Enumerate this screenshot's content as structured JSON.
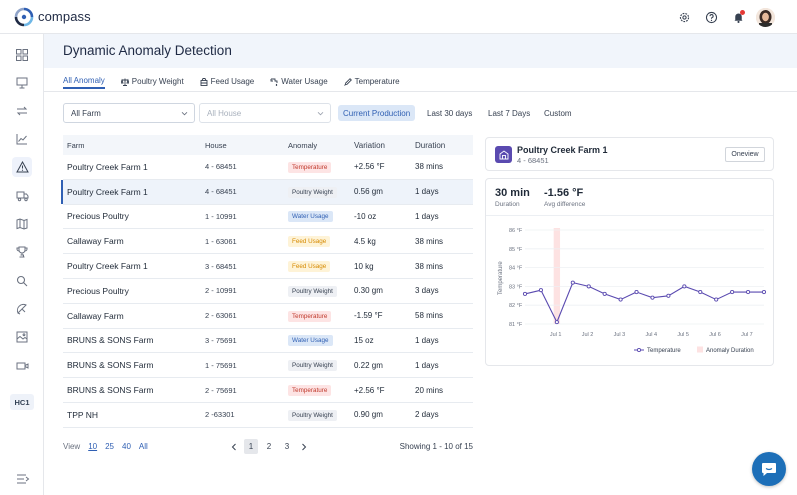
{
  "app": {
    "name": "compass"
  },
  "header": {
    "title": "Dynamic Anomaly Detection"
  },
  "sidebar": {
    "items": [
      {
        "icon": "grid-icon"
      },
      {
        "icon": "presentation-icon"
      },
      {
        "icon": "transfer-icon"
      },
      {
        "icon": "line-chart-icon"
      },
      {
        "icon": "warning-icon",
        "active": true
      },
      {
        "icon": "truck-icon"
      },
      {
        "icon": "map-icon"
      },
      {
        "icon": "trophy-icon"
      },
      {
        "icon": "search-icon"
      },
      {
        "icon": "satellite-icon"
      },
      {
        "icon": "image-icon"
      },
      {
        "icon": "video-icon"
      }
    ],
    "badge": "HC1"
  },
  "tabs": [
    {
      "label": "All Anomaly",
      "active": true
    },
    {
      "label": "Poultry Weight",
      "icon": "scale-icon"
    },
    {
      "label": "Feed Usage",
      "icon": "feed-icon"
    },
    {
      "label": "Water Usage",
      "icon": "water-icon"
    },
    {
      "label": "Temperature",
      "icon": "thermometer-icon"
    }
  ],
  "filters": {
    "farm": "All Farm",
    "house_placeholder": "All House",
    "periods": [
      "Current Production",
      "Last 30 days",
      "Last 7 Days",
      "Custom"
    ],
    "active_period": "Current Production"
  },
  "table": {
    "columns": [
      "Farm",
      "House",
      "Anomaly",
      "Variation",
      "Duration"
    ],
    "rows": [
      {
        "farm": "Poultry Creek Farm 1",
        "house": "4 - 68451",
        "anomaly": "Temperature",
        "variation": "+2.56  °F",
        "duration": "38 mins"
      },
      {
        "farm": "Poultry Creek Farm 1",
        "house": "4 - 68451",
        "anomaly": "Poultry Weight",
        "variation": "0.56 gm",
        "duration": "1 days"
      },
      {
        "farm": "Precious Poultry",
        "house": "1 - 10991",
        "anomaly": "Water Usage",
        "variation": "-10 oz",
        "duration": "1 days"
      },
      {
        "farm": "Callaway Farm",
        "house": "1 - 63061",
        "anomaly": "Feed Usage",
        "variation": "4.5 kg",
        "duration": "38 mins"
      },
      {
        "farm": "Poultry Creek Farm 1",
        "house": "3 - 68451",
        "anomaly": "Feed Usage",
        "variation": "10 kg",
        "duration": "38 mins"
      },
      {
        "farm": "Precious Poultry",
        "house": "2 - 10991",
        "anomaly": "Poultry Weight",
        "variation": "0.30 gm",
        "duration": "3 days"
      },
      {
        "farm": "Callaway Farm",
        "house": "2 - 63061",
        "anomaly": "Temperature",
        "variation": "-1.59  °F",
        "duration": "58 mins"
      },
      {
        "farm": "BRUNS & SONS Farm",
        "house": "3 - 75691",
        "anomaly": "Water Usage",
        "variation": "15 oz",
        "duration": "1 days"
      },
      {
        "farm": "BRUNS & SONS Farm",
        "house": "1 - 75691",
        "anomaly": "Poultry Weight",
        "variation": "0.22 gm",
        "duration": "1 days"
      },
      {
        "farm": "BRUNS & SONS Farm",
        "house": "2 - 75691",
        "anomaly": "Temperature",
        "variation": "+2.56  °F",
        "duration": "20 mins"
      },
      {
        "farm": "TPP NH",
        "house": "2 -63301",
        "anomaly": "Poultry Weight",
        "variation": "0.90 gm",
        "duration": "2 days"
      }
    ],
    "selected_row": 1
  },
  "pagination": {
    "view_label": "View",
    "page_sizes": [
      "10",
      "25",
      "40",
      "All"
    ],
    "current_size": "10",
    "pages": [
      "1",
      "2",
      "3"
    ],
    "current_page": "1",
    "showing": "Showing 1 - 10 of 15"
  },
  "detail": {
    "farm_name": "Poultry Creek Farm 1",
    "house": "4 - 68451",
    "oneview_label": "Oneview",
    "duration_value": "30 min",
    "duration_label": "Duration",
    "avg_value": "-1.56 °F",
    "avg_label": "Avg difference"
  },
  "chart_data": {
    "type": "line",
    "ylabel": "Temperature",
    "ylim": [
      81,
      86
    ],
    "yticks": [
      "86 °F",
      "85 °F",
      "84 °F",
      "83 °F",
      "82 °F",
      "81 °F"
    ],
    "x_tick_labels": [
      "Jul 1",
      "Jul 2",
      "Jul 3",
      "Jul 4",
      "Jul 5",
      "Jul 6",
      "Jul 7"
    ],
    "x_range": [
      0,
      7.5
    ],
    "series": [
      {
        "name": "Temperature",
        "color": "#5a4ab0",
        "x": [
          0,
          0.5,
          1.0,
          1.5,
          2.0,
          2.5,
          3.0,
          3.5,
          4.0,
          4.5,
          5.0,
          5.5,
          6.0,
          6.5,
          7.0,
          7.5
        ],
        "y": [
          82.6,
          82.8,
          81.1,
          83.2,
          83.0,
          82.6,
          82.3,
          82.7,
          82.4,
          82.5,
          83.0,
          82.7,
          82.3,
          82.7,
          82.7,
          82.7
        ]
      }
    ],
    "anomaly_band": {
      "name": "Anomaly Duration",
      "x_start": 0.9,
      "x_end": 1.1,
      "color": "#fde2e2"
    },
    "legend": "bottom-right"
  }
}
